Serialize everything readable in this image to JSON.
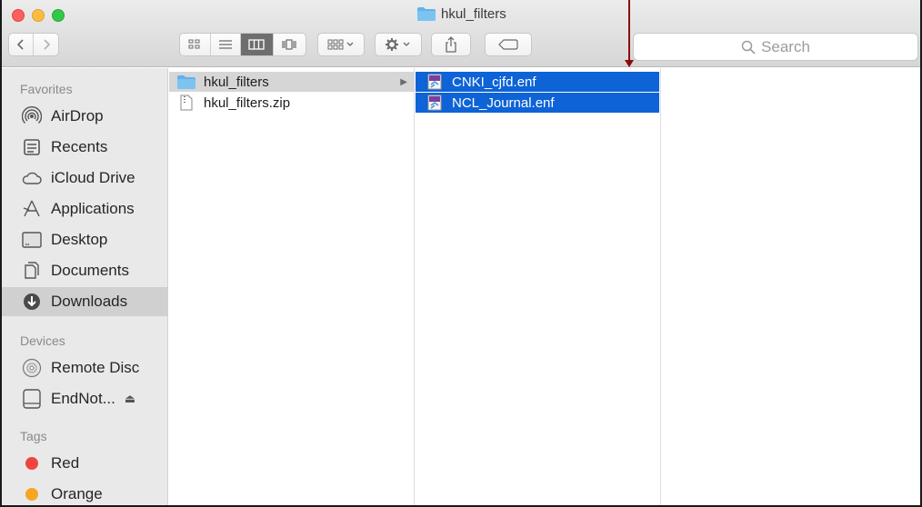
{
  "window": {
    "title": "hkul_filters"
  },
  "toolbar": {
    "back_label": "‹",
    "forward_label": "›",
    "search_placeholder": "Search",
    "view_buttons": [
      "icon-view-icon",
      "list-view-icon",
      "column-view-icon",
      "cover-flow-icon"
    ],
    "active_view": "column-view-icon"
  },
  "sidebar": {
    "favorites_header": "Favorites",
    "favorites": [
      {
        "label": "AirDrop",
        "icon": "airdrop-icon"
      },
      {
        "label": "Recents",
        "icon": "recents-icon"
      },
      {
        "label": "iCloud Drive",
        "icon": "cloud-icon"
      },
      {
        "label": "Applications",
        "icon": "applications-icon"
      },
      {
        "label": "Desktop",
        "icon": "desktop-icon"
      },
      {
        "label": "Documents",
        "icon": "documents-icon"
      },
      {
        "label": "Downloads",
        "icon": "downloads-icon",
        "selected": true
      }
    ],
    "devices_header": "Devices",
    "devices": [
      {
        "label": "Remote Disc",
        "icon": "disc-icon"
      },
      {
        "label": "EndNot...",
        "icon": "drive-icon",
        "eject": "⏏"
      }
    ],
    "tags_header": "Tags",
    "tags": [
      {
        "label": "Red",
        "color": "#f0453f"
      },
      {
        "label": "Orange",
        "color": "#f5a623"
      }
    ]
  },
  "columns": {
    "col1": [
      {
        "name": "hkul_filters",
        "type": "folder",
        "selected": true
      },
      {
        "name": "hkul_filters.zip",
        "type": "zip"
      }
    ],
    "col2": [
      {
        "name": "CNKI_cjfd.enf",
        "type": "enf",
        "selected": true
      },
      {
        "name": "NCL_Journal.enf",
        "type": "enf",
        "selected": true
      }
    ]
  },
  "colors": {
    "selection_blue": "#0e63d6",
    "annotation_arrow": "#8b0a0a",
    "folder_blue": "#5fb3ec"
  }
}
